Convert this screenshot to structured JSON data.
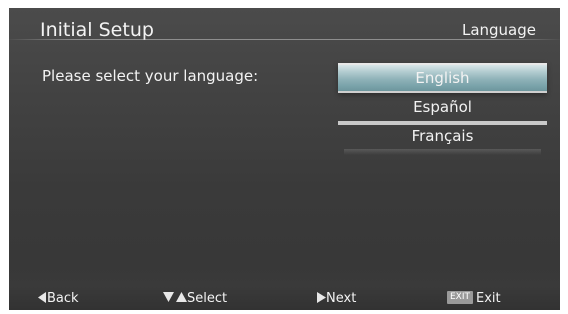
{
  "header": {
    "title": "Initial Setup",
    "page_name": "Language"
  },
  "main": {
    "prompt": "Please select your language:",
    "languages": [
      {
        "label": "English",
        "selected": true
      },
      {
        "label": "Español",
        "selected": false
      },
      {
        "label": "Français",
        "selected": false
      }
    ]
  },
  "footer": {
    "back_label": "Back",
    "back_icon": "left-triangle-icon",
    "select_label": "Select",
    "select_icon": "up-down-triangle-icon",
    "next_label": "Next",
    "next_icon": "right-triangle-icon",
    "exit_key": "EXIT",
    "exit_label": "Exit"
  },
  "colors": {
    "background": "#404040",
    "highlight": "#9dbcc2",
    "text": "#f3f3f3"
  }
}
